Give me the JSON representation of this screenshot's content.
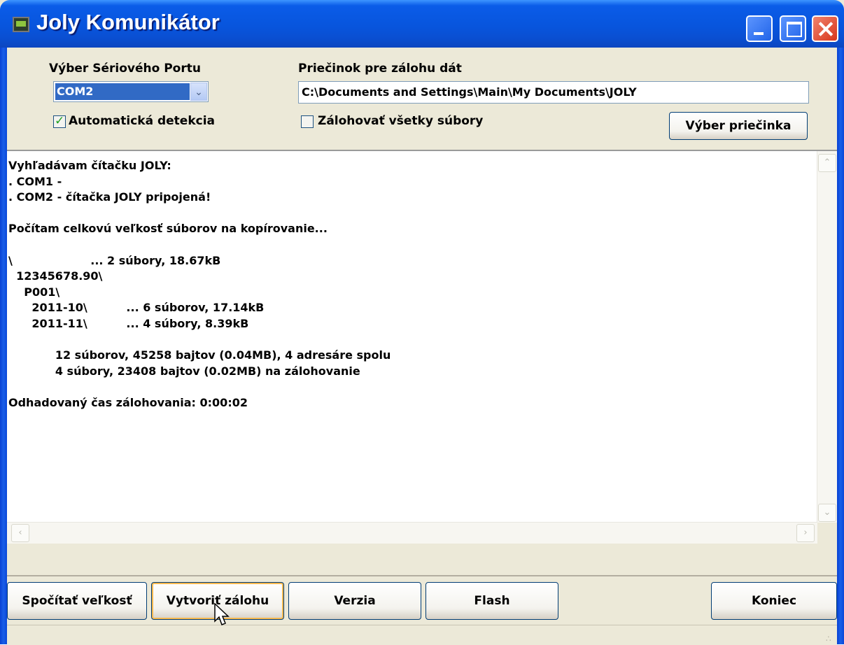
{
  "window": {
    "title": "Joly Komunikátor"
  },
  "port": {
    "label": "Výber Sériového Portu",
    "selected": "COM2",
    "auto_detect_label": "Automatická detekcia",
    "auto_detect_checked": true
  },
  "backup": {
    "label": "Priečinok pre zálohu dát",
    "path": "C:\\Documents and Settings\\Main\\My Documents\\JOLY",
    "all_files_label": "Zálohovať všetky súbory",
    "all_files_checked": false,
    "choose_folder_button": "Výber priečinka"
  },
  "log": {
    "text": "Vyhľadávam čítačku JOLY:\n. COM1 -\n. COM2 - čítačka JOLY pripojená!\n\nPočítam celkovú veľkosť súborov na kopírovanie...\n\n\\                    ... 2 súbory, 18.67kB\n  12345678.90\\\n    P001\\\n      2011-10\\          ... 6 súborov, 17.14kB\n      2011-11\\          ... 4 súbory, 8.39kB\n\n            12 súborov, 45258 bajtov (0.04MB), 4 adresáre spolu\n            4 súbory, 23408 bajtov (0.02MB) na zálohovanie\n\nOdhadovaný čas zálohovania: 0:00:02"
  },
  "buttons": {
    "compute_size": "Spočítať veľkosť",
    "create_backup": "Vytvoriť zálohu",
    "version": "Verzia",
    "flash": "Flash",
    "exit": "Koniec"
  }
}
